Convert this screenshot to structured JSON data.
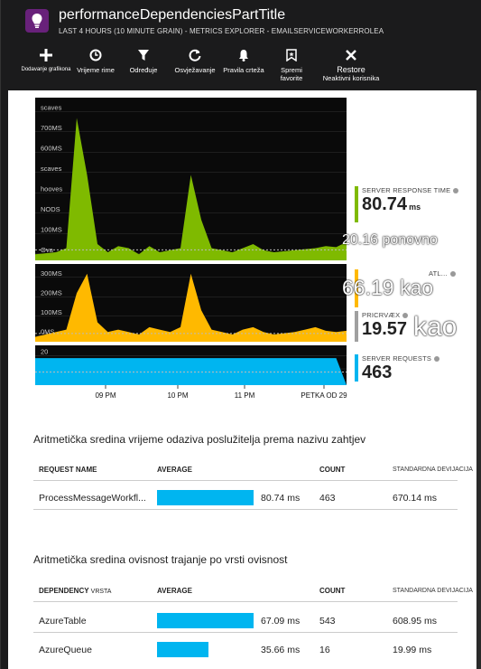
{
  "header": {
    "title": "performanceDependenciesPartTitle",
    "subtitle": "LAST 4 HOURS (10 MINUTE GRAIN) - METRICS EXPLORER - EMAILSERVICEWORKERROLEA"
  },
  "toolbar": {
    "add_chart": "Dodavanje grafikona",
    "time_range": "Vrijeme rime",
    "filter": "Određuje",
    "refresh": "Osvježavanje",
    "alert_rules": "Pravila crteža",
    "save_favorite": [
      "Spremi",
      "favorite"
    ],
    "restore": "Restore",
    "restore_sub": "Neaktivni korisnika"
  },
  "colors": {
    "green": "#7fba00",
    "yellow": "#ffb900",
    "blue": "#00b5f0",
    "gray": "#a0a0a0"
  },
  "chart": {
    "y_labels_top": [
      "scaves",
      "700MS",
      "600MS",
      "scaves",
      "hooves",
      "NODS",
      "100MS",
      "Ova"
    ],
    "y_labels_mid": [
      "300MS",
      "200MS",
      "100MS",
      "0MS"
    ],
    "y_labels_bot": [
      "20",
      "10",
      "0"
    ],
    "x_labels": [
      "09 PM",
      "10 PM",
      "11 PM",
      "PETKA OD 29"
    ]
  },
  "chart_data": [
    {
      "type": "area",
      "title": "",
      "series": [
        {
          "name": "SERVER RESPONSE TIME",
          "values": [
            30,
            35,
            40,
            60,
            700,
            420,
            80,
            40,
            70,
            60,
            30,
            70,
            40,
            50,
            60,
            420,
            200,
            60,
            50,
            40,
            60,
            80,
            50,
            40,
            45,
            50,
            55,
            60,
            70,
            65,
            90
          ]
        }
      ],
      "ylim": [
        0,
        800
      ]
    },
    {
      "type": "area",
      "title": "",
      "series": [
        {
          "name": "ATL",
          "values": [
            20,
            30,
            40,
            50,
            200,
            280,
            80,
            40,
            50,
            40,
            30,
            60,
            50,
            40,
            60,
            280,
            130,
            50,
            40,
            30,
            50,
            60,
            40,
            30,
            35,
            40,
            50,
            60,
            45,
            40,
            45
          ]
        }
      ],
      "ylim": [
        0,
        320
      ]
    },
    {
      "type": "area",
      "title": "",
      "series": [
        {
          "name": "SERVER REQUESTS",
          "values": [
            17,
            17,
            17,
            17,
            17,
            17,
            17,
            17,
            17,
            17,
            17,
            17,
            17,
            17,
            17,
            17,
            17,
            17,
            17,
            17,
            17,
            17,
            17,
            17,
            17,
            17,
            17,
            17,
            17,
            17,
            0
          ]
        }
      ],
      "ylim": [
        0,
        25
      ]
    }
  ],
  "metrics": {
    "response_time": {
      "name": "SERVER RESPONSE TIME",
      "value": "80.74",
      "unit": "ms"
    },
    "overlay1": "20.16 ponovno",
    "atl": {
      "name": "ATL..."
    },
    "overlay2": "66.19 kao",
    "pricrvaex": {
      "name": "PRICRVÆX",
      "value": "19.57"
    },
    "overlay3": "kao",
    "server_requests": {
      "name": "SERVER REQUESTS",
      "value": "463"
    }
  },
  "table1": {
    "title": "Aritmetička sredina vrijeme odaziva poslužitelja prema nazivu zahtjev",
    "headers": {
      "name": "REQUEST NAME",
      "average": "AVERAGE",
      "count": "COUNT",
      "stddev": "STANDARDNA DEVIJACIJA"
    },
    "rows": [
      {
        "name": "ProcessMessageWorkfl...",
        "average": "80.74 ms",
        "bar": 1.0,
        "count": "463",
        "stddev": "670.14 ms"
      }
    ]
  },
  "table2": {
    "title": "Aritmetička sredina ovisnost trajanje po vrsti ovisnost",
    "headers": {
      "name": "DEPENDENCY",
      "name_sub": "VRSTA",
      "average": "AVERAGE",
      "count": "COUNT",
      "stddev": "STANDARDNA DEVIJACIJA"
    },
    "rows": [
      {
        "name": "AzureTable",
        "average": "67.09 ms",
        "bar": 1.0,
        "count": "543",
        "stddev": "608.95 ms"
      },
      {
        "name": "AzureQueue",
        "average": "35.66 ms",
        "bar": 0.53,
        "count": "16",
        "stddev": "19.99 ms"
      }
    ]
  }
}
